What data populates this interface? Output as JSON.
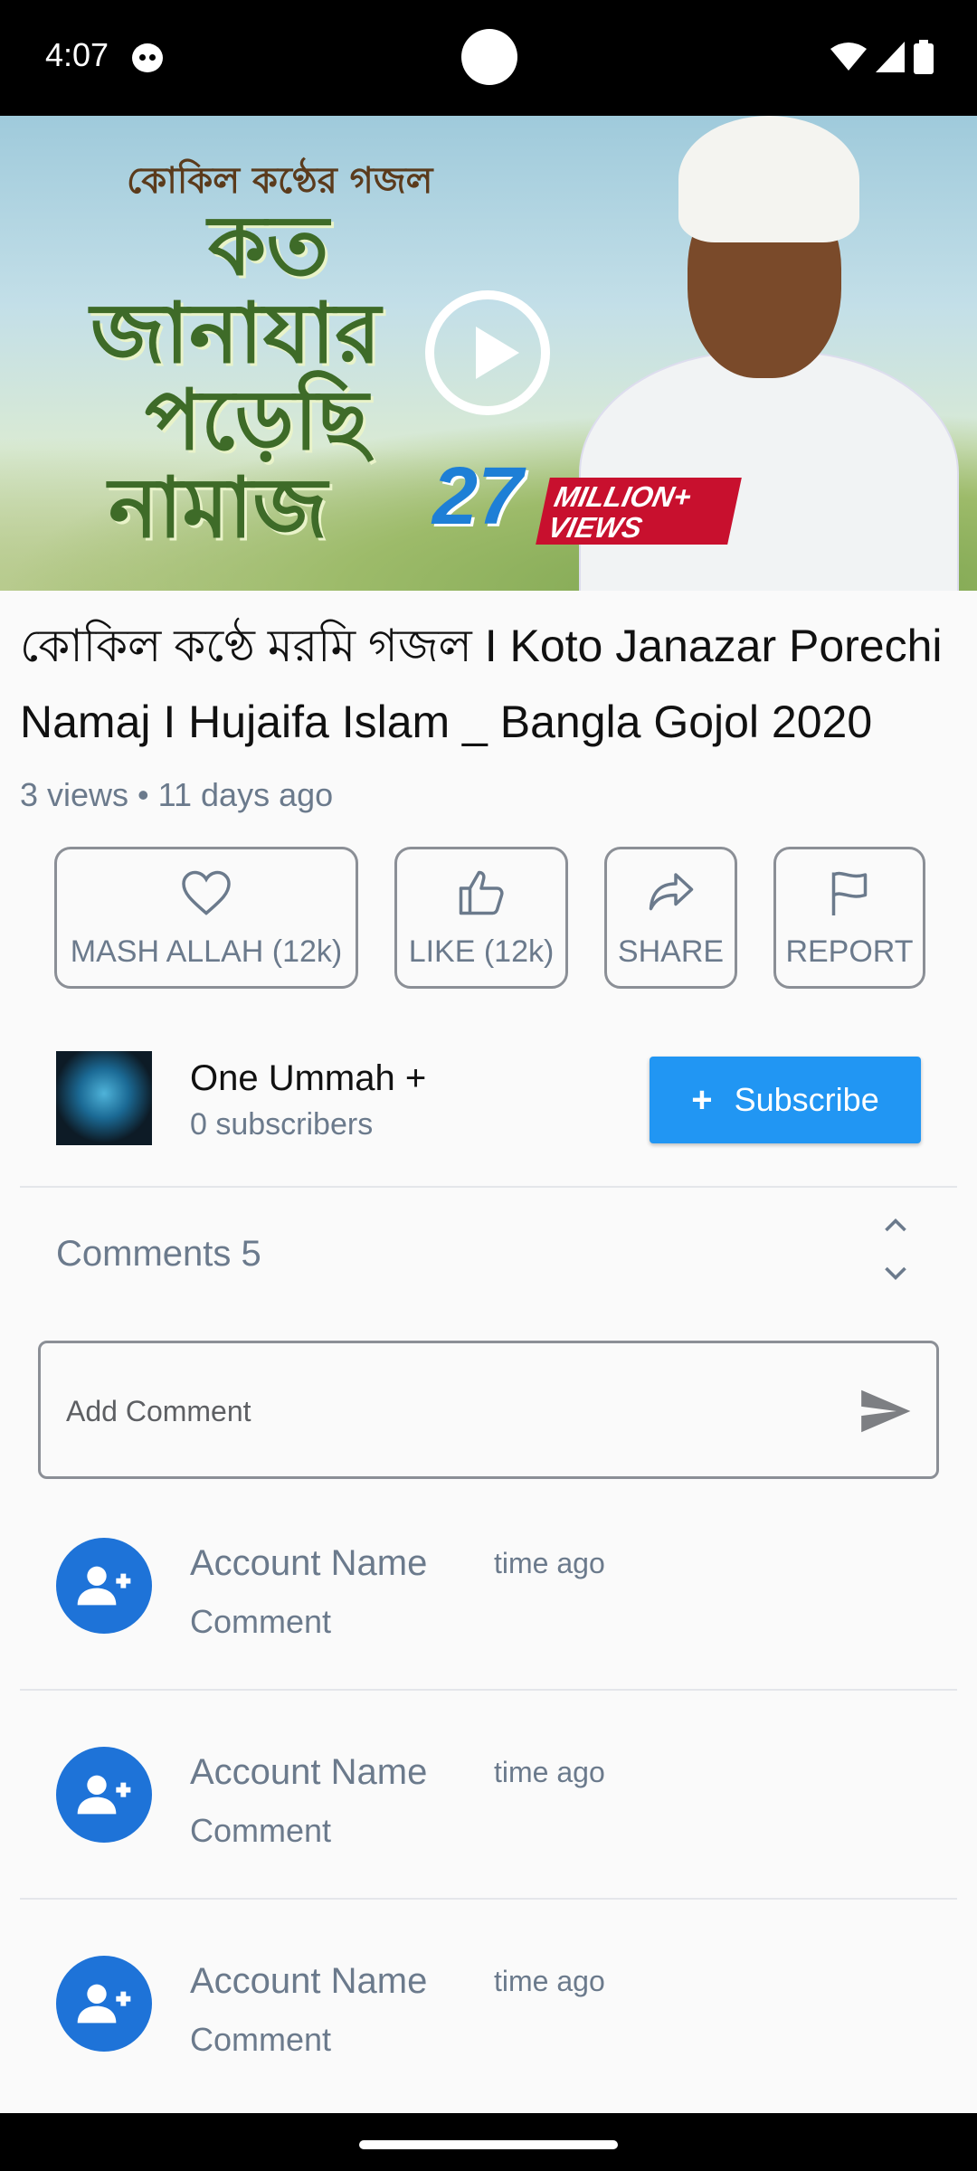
{
  "status_bar": {
    "time": "4:07"
  },
  "video": {
    "thumb_heading": "কোকিল কণ্ঠের গজল",
    "thumb_line1": "কত",
    "thumb_line2": "জানাযার",
    "thumb_line3": "পড়েছি",
    "thumb_line4": "নামাজ",
    "views_number": "27",
    "views_banner_1": "MILLION+",
    "views_banner_2": "VIEWS"
  },
  "title": "কোকিল কণ্ঠে মরমি গজল I Koto Janazar Porechi Namaj I Hujaifa Islam _ Bangla Gojol 2020",
  "meta": "3 views • 11 days ago",
  "actions": [
    {
      "label": "MASH ALLAH (12k)",
      "icon": "heart-icon"
    },
    {
      "label": "LIKE (12k)",
      "icon": "thumbs-up-icon"
    },
    {
      "label": "SHARE",
      "icon": "share-icon"
    },
    {
      "label": "REPORT",
      "icon": "flag-icon"
    }
  ],
  "channel": {
    "name": "One Ummah +",
    "subscribers": "0 subscribers",
    "subscribe_label": "Subscribe",
    "subscribe_color": "#2196f3"
  },
  "comments": {
    "title": "Comments 5",
    "placeholder": "Add Comment",
    "items": [
      {
        "account": "Account Name",
        "time": "time ago",
        "text": "Comment"
      },
      {
        "account": "Account Name",
        "time": "time ago",
        "text": "Comment"
      },
      {
        "account": "Account Name",
        "time": "time ago",
        "text": "Comment"
      }
    ],
    "avatar_color": "#1e73d8"
  }
}
